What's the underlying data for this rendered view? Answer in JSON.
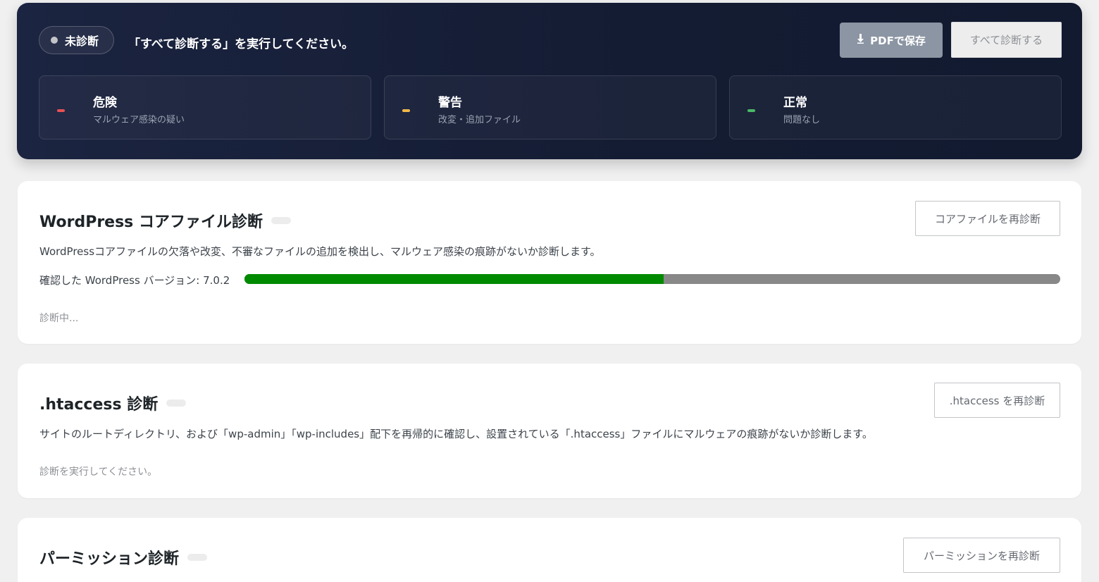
{
  "hero": {
    "status_label": "未診断",
    "message": "「すべて診断する」を実行してください。",
    "pdf_button": "PDFで保存",
    "run_all_button": "すべて診断する",
    "stats": [
      {
        "title": "危険",
        "subtitle": "マルウェア感染の疑い",
        "color": "#e65054"
      },
      {
        "title": "警告",
        "subtitle": "改変・追加ファイル",
        "color": "#f0b849"
      },
      {
        "title": "正常",
        "subtitle": "問題なし",
        "color": "#4ab866"
      }
    ]
  },
  "core": {
    "title": "WordPress コアファイル診断",
    "rescan_button": "コアファイルを再診断",
    "description": "WordPressコアファイルの欠落や改変、不審なファイルの追加を検出し、マルウェア感染の痕跡がないか診断します。",
    "version_label": "確認した WordPress バージョン: 7.0.2",
    "progress": 0.514,
    "status": "診断中..."
  },
  "htaccess": {
    "title": ".htaccess 診断",
    "rescan_button": ".htaccess を再診断",
    "description": "サイトのルートディレクトリ、および「wp-admin」「wp-includes」配下を再帰的に確認し、設置されている「.htaccess」ファイルにマルウェアの痕跡がないか診断します。",
    "status": "診断を実行してください。"
  },
  "permission": {
    "title": "パーミッション診断",
    "rescan_button": "パーミッションを再診断"
  }
}
